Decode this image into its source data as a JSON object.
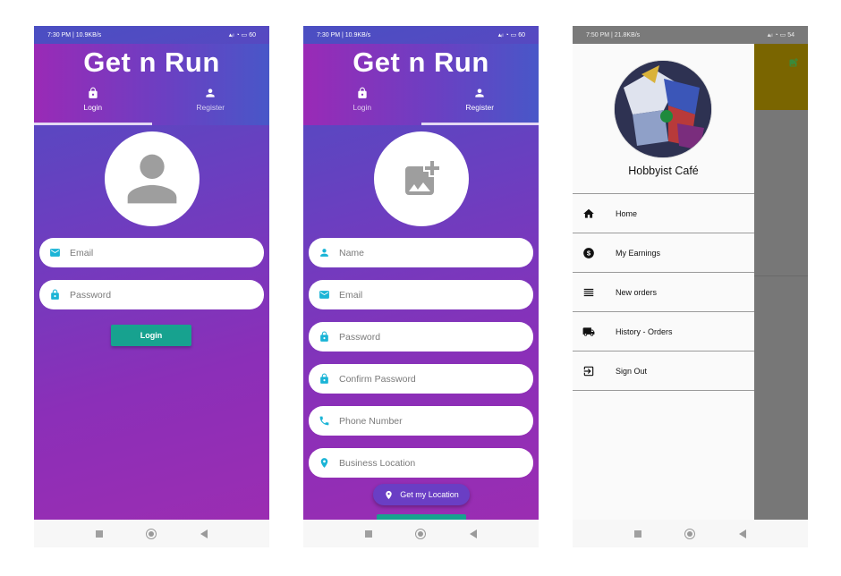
{
  "colors": {
    "teal": "#17a28f",
    "icon_teal": "#1ab4d6",
    "purple": "#6a3ec4",
    "magenta": "#9b2db2",
    "indigo": "#4a4fc2"
  },
  "login_screen": {
    "status_left": "7:30 PM | 10.9KB/s",
    "status_right": "60",
    "app_title": "Get n Run",
    "tabs": [
      {
        "label": "Login",
        "icon": "lock-icon",
        "selected": true
      },
      {
        "label": "Register",
        "icon": "person-icon",
        "selected": false
      }
    ],
    "avatar_icon": "account-placeholder-icon",
    "fields": {
      "email_placeholder": "Email",
      "password_placeholder": "Password"
    },
    "login_button": "Login"
  },
  "register_screen": {
    "status_left": "7:30 PM | 10.9KB/s",
    "status_right": "60",
    "app_title": "Get n Run",
    "tabs": [
      {
        "label": "Login",
        "icon": "lock-icon",
        "selected": false
      },
      {
        "label": "Register",
        "icon": "person-icon",
        "selected": true
      }
    ],
    "avatar_icon": "add-photo-icon",
    "fields": {
      "name_placeholder": "Name",
      "email_placeholder": "Email",
      "password_placeholder": "Password",
      "confirm_password_placeholder": "Confirm Password",
      "phone_placeholder": "Phone Number",
      "location_placeholder": "Business Location"
    },
    "location_button": "Get my Location"
  },
  "drawer_screen": {
    "status_left": "7:50 PM | 21.8KB/s",
    "status_right": "54",
    "profile_name": "Hobbyist Café",
    "items": [
      {
        "label": "Home",
        "icon": "home-icon"
      },
      {
        "label": "My Earnings",
        "icon": "dollar-icon"
      },
      {
        "label": "New orders",
        "icon": "list-icon"
      },
      {
        "label": "History - Orders",
        "icon": "truck-icon"
      },
      {
        "label": "Sign Out",
        "icon": "exit-icon"
      }
    ]
  }
}
